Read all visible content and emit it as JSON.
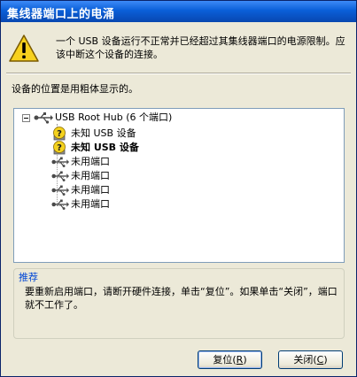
{
  "window": {
    "title": "集线器端口上的电涌"
  },
  "message": "一个 USB 设备运行不正常并已经超过其集线器端口的电源限制。应该中断这个设备的连接。",
  "location_label": "设备的位置是用粗体显示的。",
  "tree": {
    "root": "USB Root Hub (6 个端口)",
    "items": [
      {
        "label": "未知 USB 设备",
        "icon": "unknown-device-icon",
        "bold": false
      },
      {
        "label": "未知 USB 设备",
        "icon": "unknown-device-icon",
        "bold": true
      },
      {
        "label": "未用端口",
        "icon": "usb-port-icon",
        "bold": false
      },
      {
        "label": "未用端口",
        "icon": "usb-port-icon",
        "bold": false
      },
      {
        "label": "未用端口",
        "icon": "usb-port-icon",
        "bold": false
      },
      {
        "label": "未用端口",
        "icon": "usb-port-icon",
        "bold": false
      }
    ]
  },
  "recommendation": {
    "title": "推荐",
    "text": "要重新启用端口，请断开硬件连接，单击“复位”。如果单击“关闭”，端口就不工作了。"
  },
  "buttons": {
    "reset_label": "复位",
    "reset_key": "R",
    "close_label": "关闭",
    "close_key": "C"
  },
  "colors": {
    "title_bar": "#0a5fd8",
    "accent_text": "#0046d5",
    "dialog_bg": "#ece9d8"
  }
}
